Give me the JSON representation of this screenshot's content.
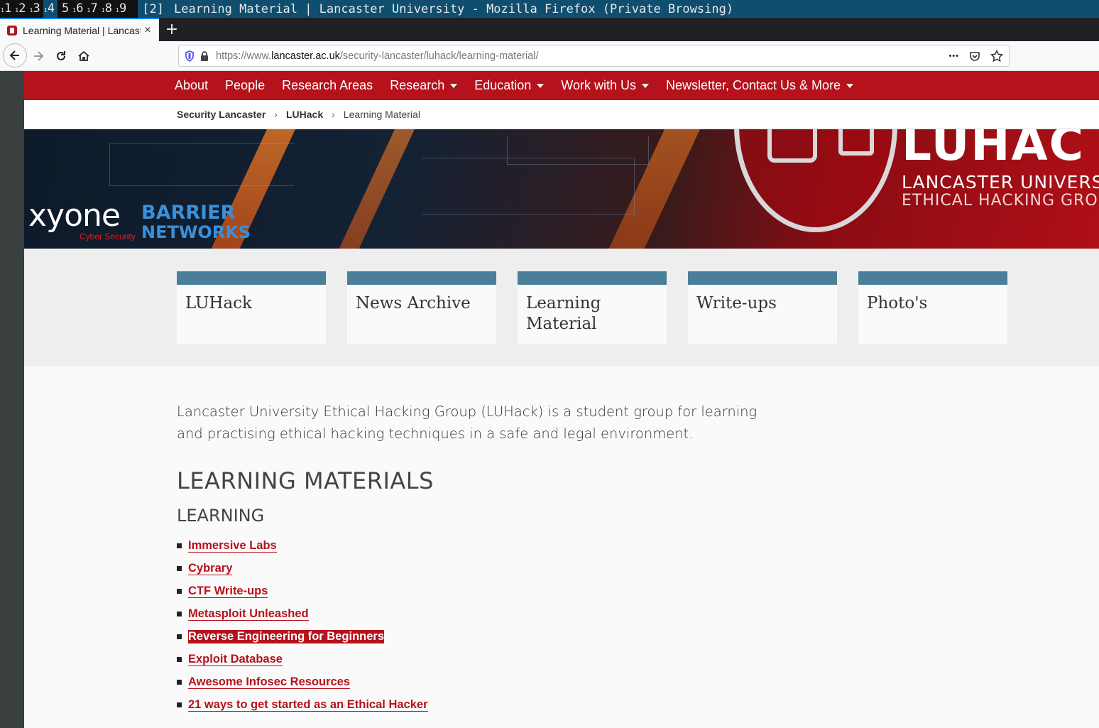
{
  "wm": {
    "workspaces": [
      {
        "num": "1",
        "sup": "1"
      },
      {
        "num": "2",
        "sup": "1"
      },
      {
        "num": "3",
        "sup": "1"
      },
      {
        "num": "4",
        "sup": "1"
      },
      {
        "num": "5",
        "sup": ""
      },
      {
        "num": "6",
        "sup": "1"
      },
      {
        "num": "7",
        "sup": "1"
      },
      {
        "num": "8",
        "sup": "1"
      },
      {
        "num": "9",
        "sup": "1"
      }
    ],
    "active_workspace": "4",
    "layout": "[2]",
    "window_title": "Learning Material | Lancaster University - Mozilla Firefox (Private Browsing)"
  },
  "browser": {
    "tab_title": "Learning Material | Lancaster University",
    "new_tab": "+",
    "close": "×",
    "url_prefix": "https://www.",
    "url_domain": "lancaster.ac.uk",
    "url_path": "/security-lancaster/luhack/learning-material/",
    "menu_dots": "•••"
  },
  "sitenav": {
    "items": [
      {
        "label": "About",
        "dropdown": false
      },
      {
        "label": "People",
        "dropdown": false
      },
      {
        "label": "Research Areas",
        "dropdown": false
      },
      {
        "label": "Research",
        "dropdown": true
      },
      {
        "label": "Education",
        "dropdown": true
      },
      {
        "label": "Work with Us",
        "dropdown": true
      },
      {
        "label": "Newsletter, Contact Us & More",
        "dropdown": true
      }
    ]
  },
  "breadcrumb": {
    "items": [
      "Security Lancaster",
      "LUHack"
    ],
    "current": "Learning Material",
    "separator": "›"
  },
  "banner": {
    "xyone": "xyone",
    "xyone_sub": "Cyber Security",
    "barrier": "BARRIER",
    "networks": "NETWORKS",
    "luhack": "LUHAC",
    "university": "LANCASTER UNIVERSITY",
    "group": "ETHICAL HACKING GROUP"
  },
  "cards": [
    {
      "title": "LUHack"
    },
    {
      "title": "News Archive"
    },
    {
      "title": "Learning Material"
    },
    {
      "title": "Write-ups"
    },
    {
      "title": "Photo's"
    }
  ],
  "content": {
    "intro": "Lancaster University Ethical Hacking Group (LUHack) is a student group for learning and practising ethical hacking techniques in a safe and legal environment.",
    "heading": "LEARNING MATERIALS",
    "subheading": "LEARNING",
    "links": [
      {
        "label": "Immersive Labs",
        "selected": false
      },
      {
        "label": "Cybrary",
        "selected": false
      },
      {
        "label": "CTF Write-ups",
        "selected": false
      },
      {
        "label": "Metasploit Unleashed",
        "selected": false
      },
      {
        "label": "Reverse Engineering for Beginners",
        "selected": true
      },
      {
        "label": "Exploit Database",
        "selected": false
      },
      {
        "label": "Awesome Infosec Resources",
        "selected": false
      },
      {
        "label": "21 ways to get started as an Ethical Hacker",
        "selected": false
      }
    ]
  },
  "colors": {
    "brand_red": "#b5121b",
    "card_accent": "#4b7f99",
    "wm_bar": "#0f4e6e"
  }
}
